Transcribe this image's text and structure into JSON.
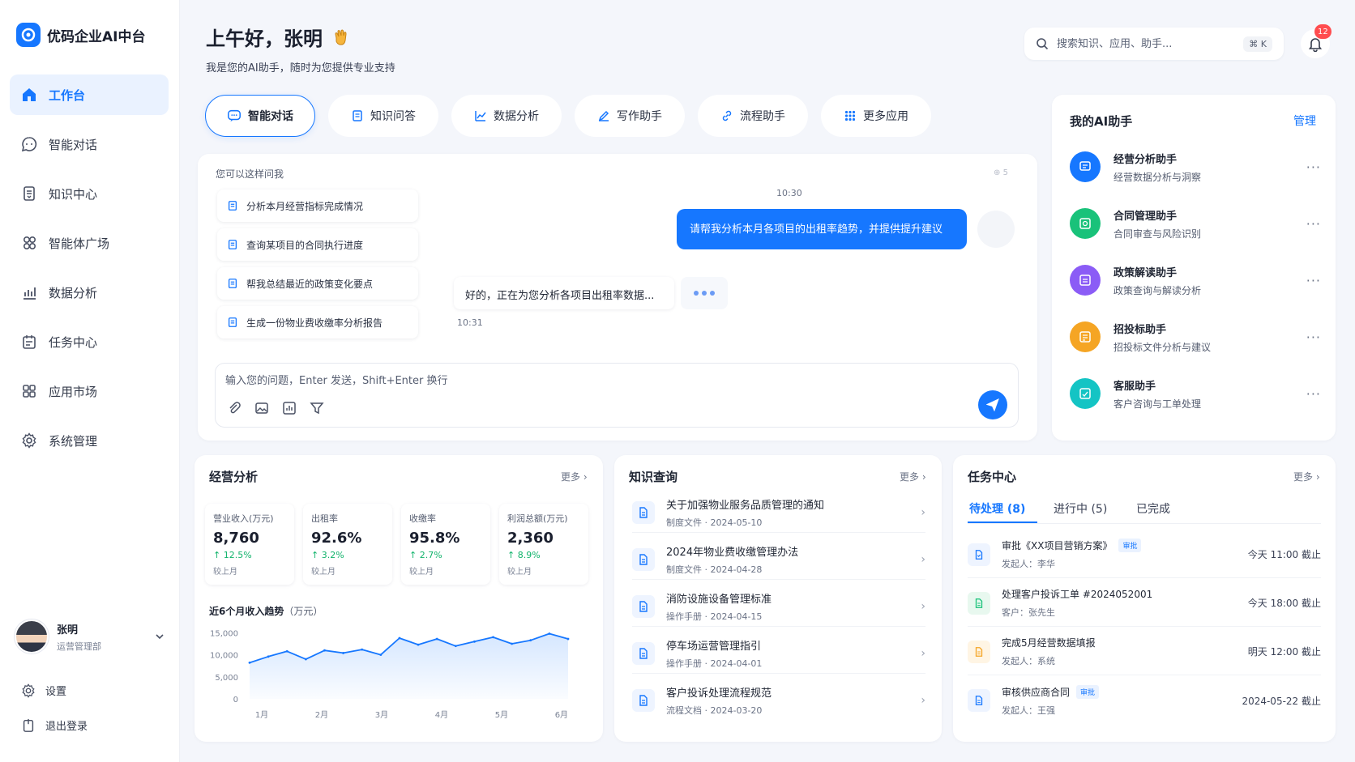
{
  "brand": {
    "name": "优码企业AI中台"
  },
  "sidebar": {
    "items": [
      {
        "label": "工作台",
        "icon": "home-icon",
        "active": true
      },
      {
        "label": "智能对话",
        "icon": "chat-icon"
      },
      {
        "label": "知识中心",
        "icon": "book-icon"
      },
      {
        "label": "智能体广场",
        "icon": "agents-icon"
      },
      {
        "label": "数据分析",
        "icon": "bar-chart-icon"
      },
      {
        "label": "任务中心",
        "icon": "calendar-icon"
      },
      {
        "label": "应用市场",
        "icon": "grid-icon"
      },
      {
        "label": "系统管理",
        "icon": "gear-icon"
      }
    ],
    "user": {
      "name": "张明",
      "dept": "运营管理部"
    },
    "settings": "设置",
    "logout": "退出登录"
  },
  "header": {
    "greeting": "上午好，张明",
    "subtitle": "我是您的AI助手，随时为您提供专业支持",
    "search_placeholder": "搜索知识、应用、助手...",
    "search_shortcut": "⌘ K",
    "notifications": "12"
  },
  "tabs": [
    {
      "label": "智能对话",
      "active": true
    },
    {
      "label": "知识问答"
    },
    {
      "label": "数据分析"
    },
    {
      "label": "写作助手"
    },
    {
      "label": "流程助手"
    },
    {
      "label": "更多应用"
    }
  ],
  "chat": {
    "suggest_title": "您可以这样问我",
    "suggestions": [
      "分析本月经营指标完成情况",
      "查询某项目的合同执行进度",
      "帮我总结最近的政策变化要点",
      "生成一份物业费收缴率分析报告"
    ],
    "count": "5",
    "user_time": "10:30",
    "user_message": "请帮我分析本月各项目的出租率趋势，并提供提升建议",
    "bot_message": "好的，正在为您分析各项目出租率数据...",
    "bot_time": "10:31",
    "input_placeholder": "输入您的问题，Enter 发送，Shift+Enter 换行"
  },
  "assistants": {
    "title": "我的AI助手",
    "manage": "管理",
    "items": [
      {
        "name": "经营分析助手",
        "desc": "经营数据分析与洞察",
        "color": "#1677ff"
      },
      {
        "name": "合同管理助手",
        "desc": "合同审查与风险识别",
        "color": "#19c27a"
      },
      {
        "name": "政策解读助手",
        "desc": "政策查询与解读分析",
        "color": "#8b5cf6"
      },
      {
        "name": "招投标助手",
        "desc": "招投标文件分析与建议",
        "color": "#f5a524"
      },
      {
        "name": "客服助手",
        "desc": "客户咨询与工单处理",
        "color": "#14c4c4"
      }
    ]
  },
  "business": {
    "title": "经营分析",
    "more": "更多",
    "kpis": [
      {
        "label": "营业收入(万元)",
        "value": "8,760",
        "change": "↑ 12.5%",
        "sub": "较上月"
      },
      {
        "label": "出租率",
        "value": "92.6%",
        "change": "↑ 3.2%",
        "sub": "较上月"
      },
      {
        "label": "收缴率",
        "value": "95.8%",
        "change": "↑ 2.7%",
        "sub": "较上月"
      },
      {
        "label": "利润总额(万元)",
        "value": "2,360",
        "change": "↑ 8.9%",
        "sub": "较上月"
      }
    ],
    "trend_title": "近6个月收入趋势",
    "trend_unit": "（万元）"
  },
  "chart_data": {
    "type": "area",
    "title": "近6个月收入趋势",
    "ylabel": "（万元）",
    "categories": [
      "1月",
      "2月",
      "3月",
      "4月",
      "5月",
      "6月"
    ],
    "x": [
      0,
      0.5,
      1,
      1.5,
      2,
      2.5,
      3,
      3.5,
      4,
      4.5,
      5,
      5.5,
      6,
      6.5,
      7,
      7.5,
      8,
      8.5
    ],
    "values": [
      8200,
      9600,
      10800,
      9000,
      11000,
      10400,
      11200,
      10000,
      13800,
      12300,
      13600,
      12000,
      13000,
      14000,
      12500,
      13300,
      14800,
      13600
    ],
    "yticks": [
      0,
      5000,
      10000,
      15000
    ],
    "ytick_labels": [
      "0",
      "5,000",
      "10,000",
      "15,000"
    ],
    "ylim": [
      0,
      16000
    ],
    "grid": false
  },
  "knowledge": {
    "title": "知识查询",
    "more": "更多",
    "docs": [
      {
        "title": "关于加强物业服务品质管理的通知",
        "type": "制度文件",
        "date": "2024-05-10"
      },
      {
        "title": "2024年物业费收缴管理办法",
        "type": "制度文件",
        "date": "2024-04-28"
      },
      {
        "title": "消防设施设备管理标准",
        "type": "操作手册",
        "date": "2024-04-15"
      },
      {
        "title": "停车场运营管理指引",
        "type": "操作手册",
        "date": "2024-04-01"
      },
      {
        "title": "客户投诉处理流程规范",
        "type": "流程文档",
        "date": "2024-03-20"
      }
    ]
  },
  "tasks": {
    "title": "任务中心",
    "more": "更多",
    "tabs": [
      "待处理 (8)",
      "进行中 (5)",
      "已完成"
    ],
    "items": [
      {
        "title": "审批《XX项目营销方案》",
        "tag": "审批",
        "meta": "发起人：李华",
        "due": "今天 11:00 截止",
        "color": "#1677ff"
      },
      {
        "title": "处理客户投诉工单 #2024052001",
        "tag": "",
        "meta": "客户：张先生",
        "due": "今天 18:00 截止",
        "color": "#19c27a"
      },
      {
        "title": "完成5月经营数据填报",
        "tag": "",
        "meta": "发起人：系统",
        "due": "明天 12:00 截止",
        "color": "#f5a524"
      },
      {
        "title": "审核供应商合同",
        "tag": "审批",
        "meta": "发起人：王强",
        "due": "2024-05-22 截止",
        "color": "#1677ff"
      }
    ]
  }
}
